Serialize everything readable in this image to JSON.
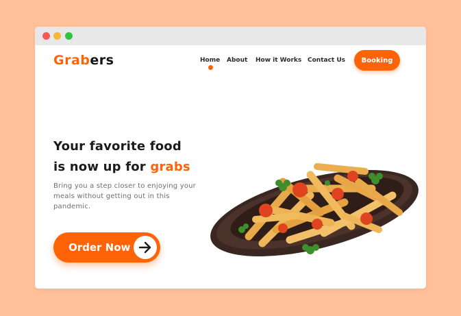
{
  "window": {
    "controls": [
      "close",
      "minimize",
      "maximize"
    ]
  },
  "brand": {
    "logo_part1": "Grab",
    "logo_part2": "ers",
    "accent_color": "#FF6308"
  },
  "nav": {
    "items": [
      {
        "label": "Home",
        "active": true
      },
      {
        "label": "About"
      },
      {
        "label": "How it Works"
      },
      {
        "label": "Contact Us"
      }
    ],
    "cta_label": "Booking"
  },
  "hero": {
    "headline_line1": "Your favorite food",
    "headline_line2_prefix": "is now up for ",
    "headline_line2_accent": "grabs",
    "subtext": "Bring you a step closer to enjoying your meals without getting out in this pandemic.",
    "cta_label": "Order Now",
    "cta_icon": "arrow-right-icon",
    "image": "pasta-dish"
  },
  "colors": {
    "background": "#FFC09A",
    "primary": "#FF6308",
    "text": "#1b1b1b"
  }
}
